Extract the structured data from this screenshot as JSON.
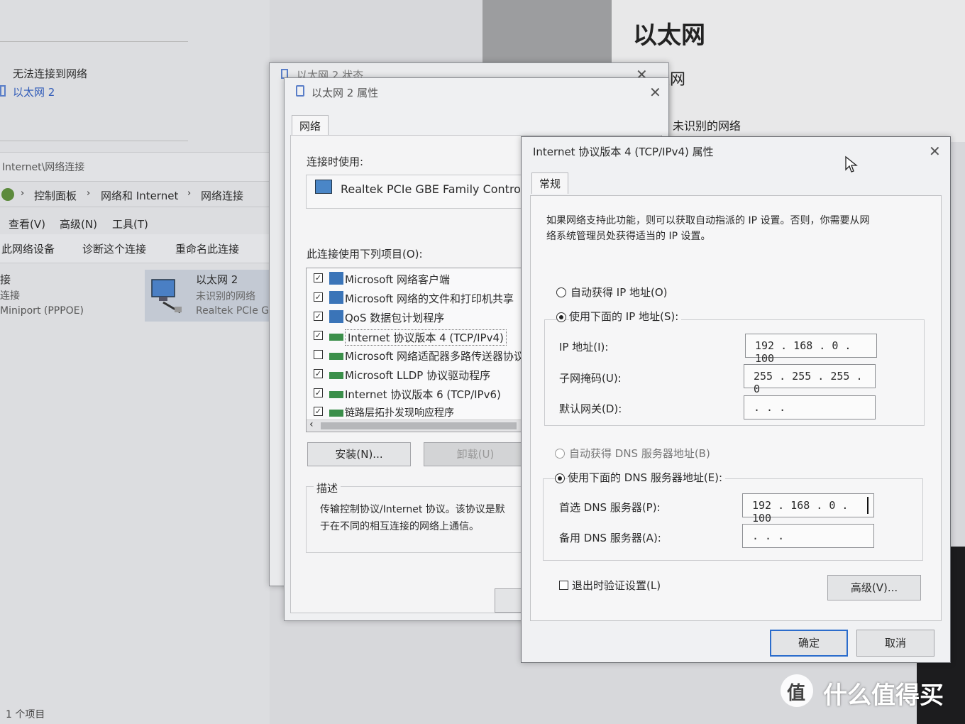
{
  "background": {
    "status_no_connect": "无法连接到网络",
    "net_item_link": "以太网 2",
    "address_path": "Internet\\网络连接",
    "breadcrumb": [
      "控制面板",
      "网络和 Internet",
      "网络连接"
    ],
    "menu": [
      "查看(V)",
      "高级(N)",
      "工具(T)"
    ],
    "toolbar": [
      "此网络设备",
      "诊断这个连接",
      "重命名此连接"
    ],
    "left_col": [
      "接",
      "连接",
      "Miniport (PPPOE)"
    ],
    "adapter": {
      "name": "以太网 2",
      "status": "未识别的网络",
      "device": "Realtek PCIe G"
    },
    "status_bar": "1 个项目",
    "settings_title": "以太网",
    "settings_subtitle": "太网",
    "settings_network": "未识别的网络"
  },
  "status_window": {
    "title": "以太网 2 状态"
  },
  "props_window": {
    "title": "以太网 2 属性",
    "tab": "网络",
    "connect_using_label": "连接时使用:",
    "adapter_name": "Realtek PCIe GBE Family Controller",
    "items_label": "此连接使用下列项目(O):",
    "items": [
      {
        "label": "Microsoft 网络客户端",
        "checked": true
      },
      {
        "label": "Microsoft 网络的文件和打印机共享",
        "checked": true
      },
      {
        "label": "QoS 数据包计划程序",
        "checked": true
      },
      {
        "label": "Internet 协议版本 4 (TCP/IPv4)",
        "checked": true
      },
      {
        "label": "Microsoft 网络适配器多路传送器协议",
        "checked": false
      },
      {
        "label": "Microsoft LLDP 协议驱动程序",
        "checked": true
      },
      {
        "label": "Internet 协议版本 6 (TCP/IPv6)",
        "checked": true
      },
      {
        "label": "链路层拓扑发现响应程序",
        "checked": true
      }
    ],
    "install_button": "安装(N)...",
    "uninstall_button": "卸载(U)",
    "description_label": "描述",
    "description_text_1": "传输控制协议/Internet 协议。该协议是默",
    "description_text_2": "于在不同的相互连接的网络上通信。"
  },
  "ipv4_dialog": {
    "title": "Internet 协议版本 4 (TCP/IPv4) 属性",
    "tab": "常规",
    "intro_1": "如果网络支持此功能，则可以获取自动指派的 IP 设置。否则，你需要从网",
    "intro_2": "络系统管理员处获得适当的 IP 设置。",
    "auto_ip_label": "自动获得 IP 地址(O)",
    "manual_ip_label": "使用下面的 IP 地址(S):",
    "ip_label": "IP 地址(I):",
    "ip_value": "192 . 168 .  0  . 100",
    "mask_label": "子网掩码(U):",
    "mask_value": "255 . 255 . 255 .  0",
    "gateway_label": "默认网关(D):",
    "gateway_value": "      .      .      .",
    "auto_dns_label": "自动获得 DNS 服务器地址(B)",
    "manual_dns_label": "使用下面的 DNS 服务器地址(E):",
    "pref_dns_label": "首选 DNS 服务器(P):",
    "pref_dns_value": "192 . 168 .  0  . 100",
    "alt_dns_label": "备用 DNS 服务器(A):",
    "alt_dns_value": "      .      .      .",
    "validate_label": "退出时验证设置(L)",
    "advanced_button": "高级(V)...",
    "ok_button": "确定",
    "cancel_button": "取消"
  },
  "watermark": {
    "glyph": "值",
    "text": "什么值得买"
  }
}
